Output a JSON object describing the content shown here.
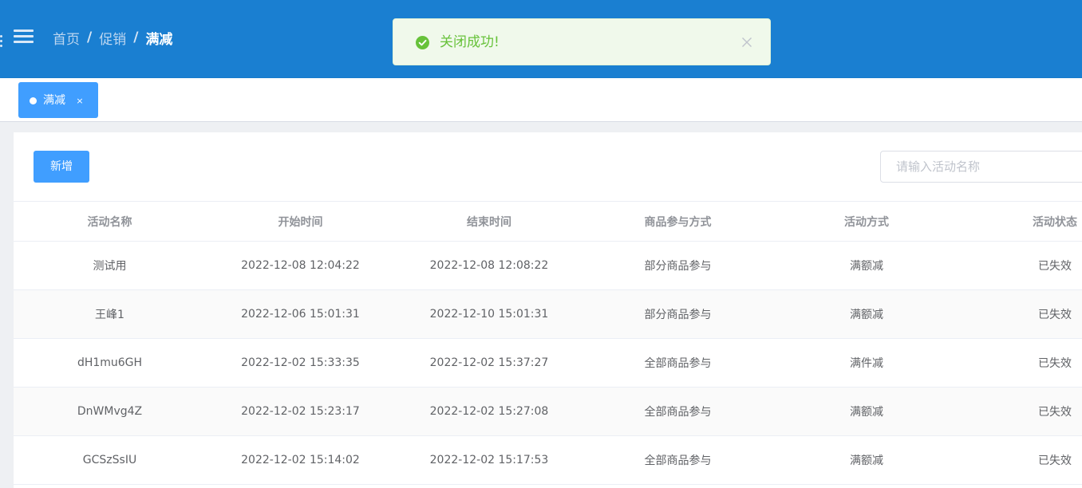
{
  "header": {
    "breadcrumb": [
      "首页",
      "促销",
      "满减"
    ],
    "separator": "/"
  },
  "toast": {
    "message": "关闭成功!",
    "type": "success",
    "color": "#67c23a"
  },
  "tags": [
    {
      "label": "满减",
      "close": "×",
      "active": true
    }
  ],
  "toolbar": {
    "add_label": "新增",
    "search_placeholder": "请输入活动名称",
    "search_value": ""
  },
  "table": {
    "columns": [
      "活动名称",
      "开始时间",
      "结束时间",
      "商品参与方式",
      "活动方式",
      "活动状态"
    ],
    "rows": [
      [
        "测试用",
        "2022-12-08 12:04:22",
        "2022-12-08 12:08:22",
        "部分商品参与",
        "满额减",
        "已失效"
      ],
      [
        "王峰1",
        "2022-12-06 15:01:31",
        "2022-12-10 15:01:31",
        "部分商品参与",
        "满额减",
        "已失效"
      ],
      [
        "dH1mu6GH",
        "2022-12-02 15:33:35",
        "2022-12-02 15:37:27",
        "全部商品参与",
        "满件减",
        "已失效"
      ],
      [
        "DnWMvg4Z",
        "2022-12-02 15:23:17",
        "2022-12-02 15:27:08",
        "全部商品参与",
        "满额减",
        "已失效"
      ],
      [
        "GCSzSsIU",
        "2022-12-02 15:14:02",
        "2022-12-02 15:17:53",
        "全部商品参与",
        "满额减",
        "已失效"
      ]
    ]
  },
  "colors": {
    "header_bg": "#1a7fd1",
    "primary": "#409eff",
    "success": "#67c23a"
  }
}
